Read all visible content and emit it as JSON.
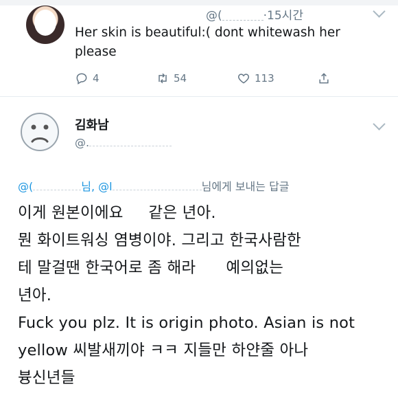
{
  "tweet": {
    "handle_prefix": "@(",
    "time": "·15시간",
    "text": "Her skin is beautiful:( dont whitewash her please",
    "actions": {
      "reply_count": "4",
      "retweet_count": "54",
      "like_count": "113"
    }
  },
  "reply": {
    "name": "김화남",
    "handle_prefix": "@.",
    "replying_to": {
      "mention1": "@(",
      "sep1": "님, @l",
      "suffix": "님에게 보내는 답글"
    },
    "lines": [
      "이게 원본이에요     같은 년아.",
      "뭔 화이트워싱 염병이야. 그리고 한국사람한",
      "테 말걸땐 한국어로 좀 해라      예의없는",
      "년아.",
      "Fuck you plz. It is origin photo. Asian is not",
      "yellow 씨발새끼야 ㅋㅋ 지들만 하얀줄 아나",
      "븅신년들"
    ]
  },
  "icons": {
    "reply": "reply-icon",
    "retweet": "retweet-icon",
    "like": "heart-icon",
    "share": "share-icon",
    "more": "chevron-down-icon",
    "avatar_default": "sad-face-icon"
  },
  "colors": {
    "secondary_text": "#657786",
    "link": "#1b95e0",
    "divider": "#e6ecf0"
  }
}
